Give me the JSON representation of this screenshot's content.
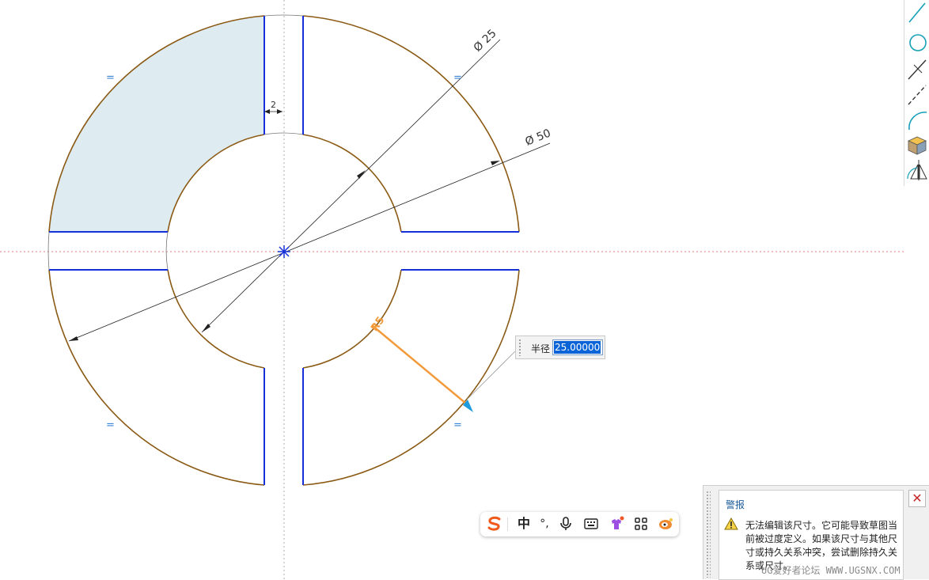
{
  "sketch": {
    "dim_outer_diameter": "Ø 50",
    "dim_inner_diameter": "Ø 25",
    "dim_slot_width": "2",
    "equal_constraint_symbol": "=",
    "radius_tag": "R5"
  },
  "radius_input": {
    "label": "半径",
    "value": "25.000000"
  },
  "right_toolbar": {
    "tools": [
      "line-icon",
      "circle-icon",
      "trim-icon",
      "dashed-line-icon",
      "arc-icon",
      "cube-icon",
      "mirror-icon"
    ]
  },
  "ime_toolbar": {
    "logo": "S",
    "mode": "中",
    "punct": "°,",
    "items": [
      "microphone-icon",
      "keyboard-icon",
      "skin-icon",
      "apps-grid-icon",
      "mascot-icon"
    ]
  },
  "alert": {
    "title": "警报",
    "message": "无法编辑该尺寸。它可能导致草图当前被过度定义。如果该尺寸与其他尺寸或持久关系冲突，尝试删除持久关系或尺寸。",
    "close_symbol": "✕"
  },
  "watermark": "UG爱好者论坛 WWW.UGSNX.COM",
  "colors": {
    "arc": "#8b5a14",
    "line": "#1530d8",
    "fill_region": "#deebf0",
    "highlight": "#f39a3a",
    "axis_red": "#e0505a",
    "alert_close": "#c62828"
  }
}
